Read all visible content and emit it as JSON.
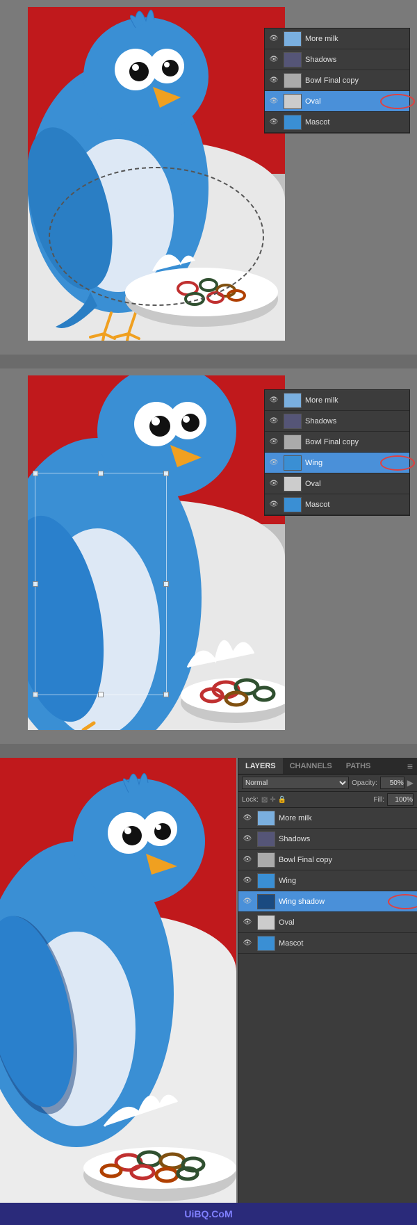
{
  "watermark": "UiBQ.CoM",
  "section1": {
    "layers": [
      {
        "id": "more-milk",
        "name": "More milk",
        "visible": true,
        "selected": false
      },
      {
        "id": "shadows",
        "name": "Shadows",
        "visible": true,
        "selected": false
      },
      {
        "id": "bowl-final-copy",
        "name": "Bowl Final copy",
        "visible": true,
        "selected": false
      },
      {
        "id": "oval",
        "name": "Oval",
        "visible": true,
        "selected": true
      },
      {
        "id": "mascot",
        "name": "Mascot",
        "visible": true,
        "selected": false
      }
    ]
  },
  "section2": {
    "layers": [
      {
        "id": "more-milk2",
        "name": "More milk",
        "visible": true,
        "selected": false
      },
      {
        "id": "shadows2",
        "name": "Shadows",
        "visible": true,
        "selected": false
      },
      {
        "id": "bowl-final-copy2",
        "name": "Bowl Final copy",
        "visible": true,
        "selected": false
      },
      {
        "id": "wing",
        "name": "Wing",
        "visible": true,
        "selected": true
      },
      {
        "id": "oval2",
        "name": "Oval",
        "visible": true,
        "selected": false
      },
      {
        "id": "mascot2",
        "name": "Mascot",
        "visible": true,
        "selected": false
      }
    ]
  },
  "section3": {
    "tabs": [
      "LAYERS",
      "CHANNELS",
      "PATHS"
    ],
    "active_tab": "LAYERS",
    "blend_mode": "Normal",
    "opacity": "50%",
    "fill": "100%",
    "lock_label": "Lock:",
    "layers": [
      {
        "id": "more-milk3",
        "name": "More milk",
        "visible": true,
        "selected": false
      },
      {
        "id": "shadows3",
        "name": "Shadows",
        "visible": true,
        "selected": false
      },
      {
        "id": "bowl-final-copy3",
        "name": "Bowl Final copy",
        "visible": true,
        "selected": false
      },
      {
        "id": "wing3",
        "name": "Wing",
        "visible": true,
        "selected": false
      },
      {
        "id": "wing-shadow",
        "name": "Wing shadow",
        "visible": true,
        "selected": true
      },
      {
        "id": "oval3",
        "name": "Oval",
        "visible": true,
        "selected": false
      },
      {
        "id": "mascot3",
        "name": "Mascot",
        "visible": true,
        "selected": false
      }
    ]
  }
}
